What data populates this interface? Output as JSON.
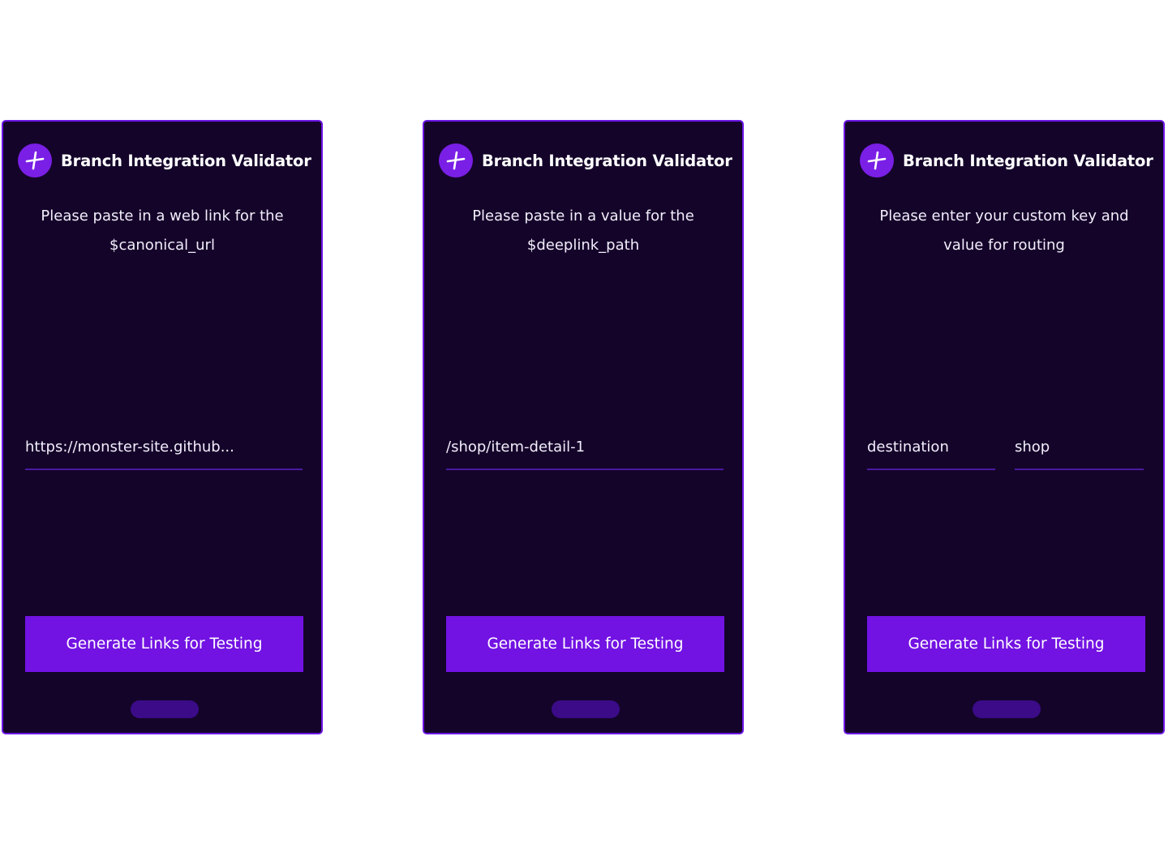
{
  "app": {
    "title": "Branch Integration Validator"
  },
  "screens": [
    {
      "prompt": "Please paste in a web link for the\n$canonical_url",
      "field_value": "https://monster-site.github...",
      "button_label": "Generate Links for Testing"
    },
    {
      "prompt": "Please paste in a value for the\n$deeplink_path",
      "field_value": "/shop/item-detail-1",
      "button_label": "Generate Links for Testing"
    },
    {
      "prompt": "Please enter your custom key and\nvalue for routing",
      "key_value": "destination",
      "value_value": "shop",
      "button_label": "Generate Links for Testing"
    }
  ],
  "colors": {
    "background": "#ffffff",
    "phone_bg": "#14042a",
    "phone_border": "#6d16e6",
    "accent": "#7212e3",
    "logo": "#7a1fe6",
    "field_underline": "#4a1aa0",
    "home_indicator": "#3b0b88"
  },
  "icons": {
    "logo": "branch-logo-icon"
  }
}
